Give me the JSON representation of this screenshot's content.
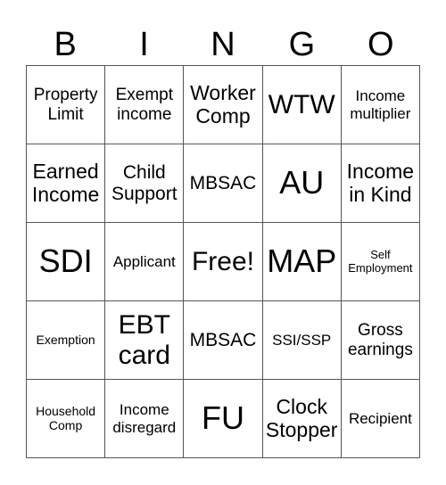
{
  "header": {
    "letters": [
      "B",
      "I",
      "N",
      "G",
      "O"
    ]
  },
  "card": {
    "cells": [
      [
        "Property Limit",
        "Exempt income",
        "Worker Comp",
        "WTW",
        "Income multiplier"
      ],
      [
        "Earned Income",
        "Child Support",
        "MBSAC",
        "AU",
        "Income in Kind"
      ],
      [
        "SDI",
        "Applicant",
        "Free!",
        "MAP",
        "Self Employment"
      ],
      [
        "Exemption",
        "EBT card",
        "MBSAC",
        "SSI/SSP",
        "Gross earnings"
      ],
      [
        "Household Comp",
        "Income disregard",
        "FU",
        "Clock Stopper",
        "Recipient"
      ]
    ]
  }
}
